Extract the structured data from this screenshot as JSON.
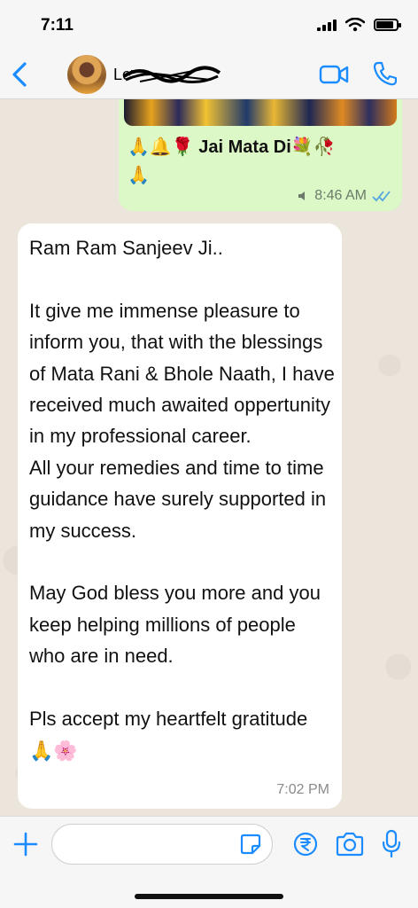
{
  "status_bar": {
    "time": "7:11",
    "battery_level": 0.85
  },
  "header": {
    "contact_name": "Le",
    "colors": {
      "accent": "#1a8cff"
    }
  },
  "messages": {
    "outgoing": {
      "text": "🙏🔔🌹 Jai Mata Di💐🥀\n🙏",
      "time": "8:46 AM",
      "status": "read",
      "icons": [
        "speaker-icon",
        "double-check-icon"
      ]
    },
    "incoming": {
      "text": "Ram Ram Sanjeev Ji..\n\nIt give me immense pleasure to inform you, that with the blessings of Mata Rani & Bhole Naath, I have received much awaited oppertunity in my professional career.\nAll your remedies and time to time guidance have surely supported in my success.\n\nMay God bless you more and you keep helping millions of people who are in need.\n\nPls accept my heartfelt gratitude 🙏🌸",
      "time": "7:02 PM"
    }
  },
  "composer": {
    "input_value": "",
    "icons": [
      "plus-icon",
      "sticker-icon",
      "rupee-icon",
      "camera-icon",
      "mic-icon"
    ]
  },
  "colors": {
    "outgoing_bubble": "#dcf8c6",
    "incoming_bubble": "#ffffff",
    "read_ticks": "#53a6e0",
    "icon_blue": "#1a8cff"
  }
}
